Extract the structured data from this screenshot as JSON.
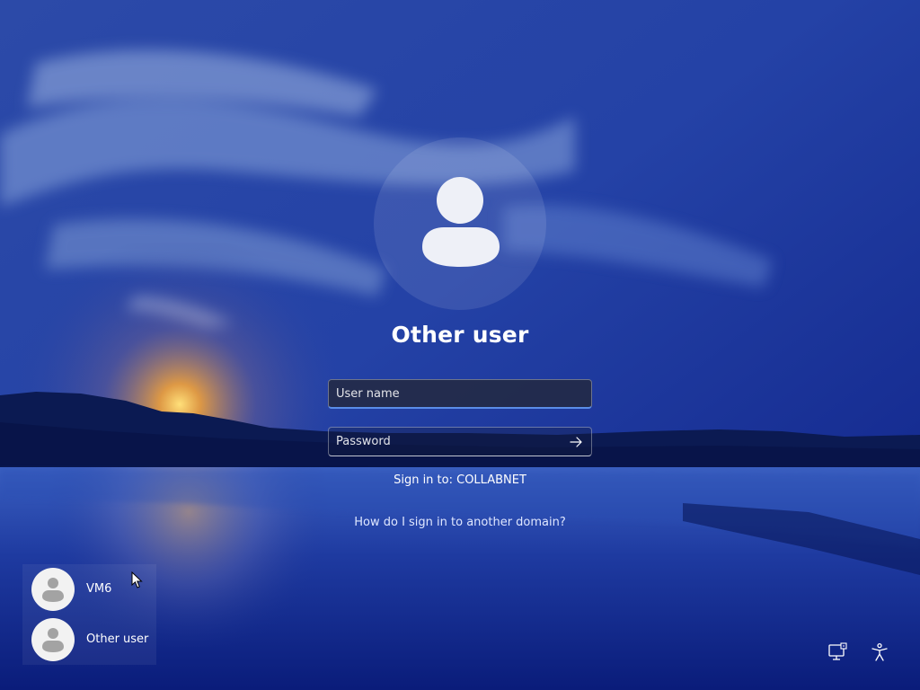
{
  "selected_user": {
    "display_name": "Other user",
    "avatar_icon": "person-icon"
  },
  "sign_in_form": {
    "username_placeholder": "User name",
    "username_value": "",
    "password_placeholder": "Password",
    "password_value": "",
    "submit_icon": "arrow-right-icon"
  },
  "domain_info": {
    "sign_in_to": "Sign in to: COLLABNET",
    "help_link": "How do I sign in to another domain?"
  },
  "user_list": [
    {
      "name": "VM6",
      "avatar_icon": "person-icon"
    },
    {
      "name": "Other user",
      "avatar_icon": "person-icon"
    }
  ],
  "corner_icons": {
    "network": "network-icon",
    "accessibility": "accessibility-icon"
  },
  "colors": {
    "background_deep": "#0b1a6e",
    "background_sky": "#2a45a8",
    "sunset_glow": "#f2a23a",
    "focus_underline": "#5a8de8",
    "text": "#ffffff"
  }
}
